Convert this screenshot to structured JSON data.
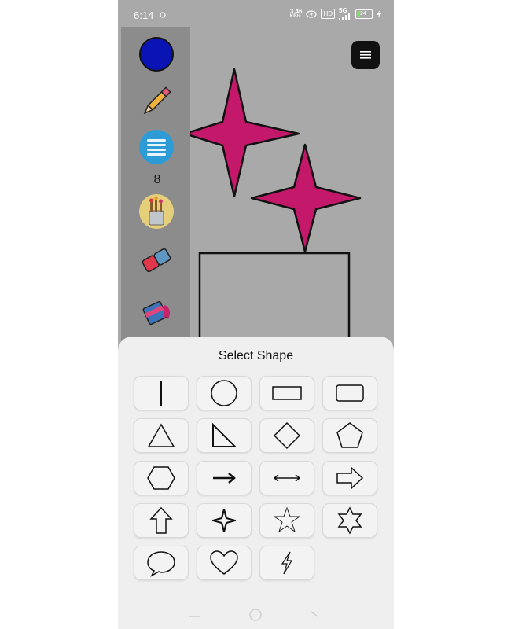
{
  "status_bar": {
    "time": "6:14",
    "net_speed_value": "3.46",
    "net_speed_unit": "KB/s",
    "network_type": "5G",
    "battery_level": "24",
    "battery_fraction": 0.24
  },
  "toolbar": {
    "brush_size": "8",
    "color_swatch": "#0a14b4"
  },
  "canvas": {
    "star_color": "#c4196a"
  },
  "sheet": {
    "title": "Select Shape",
    "shapes": [
      "line",
      "circle",
      "rectangle",
      "rounded-rectangle",
      "triangle",
      "right-triangle",
      "diamond",
      "pentagon",
      "hexagon",
      "arrow-right",
      "double-arrow",
      "block-arrow-right",
      "block-arrow-up",
      "four-point-star",
      "five-point-star",
      "six-point-star",
      "speech-bubble",
      "heart",
      "lightning"
    ]
  }
}
